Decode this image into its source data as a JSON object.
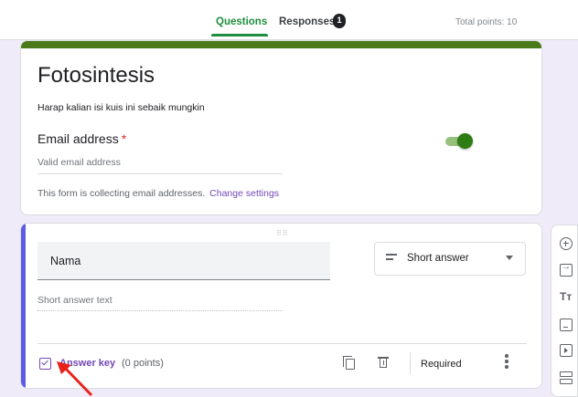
{
  "tabs": [
    {
      "label": "Questions",
      "active": true
    },
    {
      "label": "Responses",
      "active": false,
      "badge": "1"
    }
  ],
  "total_points": "Total points: 10",
  "form": {
    "title": "Fotosintesis",
    "description": "Harap kalian isi kuis ini sebaik mungkin",
    "email_label": "Email address",
    "required_marker": "*",
    "email_placeholder": "Valid email address",
    "collect_text": "This form is collecting email addresses.",
    "change_settings_link": "Change settings"
  },
  "question": {
    "title": "Nama",
    "type": "Short answer",
    "answer_placeholder": "Short answer text",
    "answer_key_label": "Answer key",
    "points": "(0 points)",
    "required_label": "Required",
    "required_on": true
  },
  "side_tools": [
    "add-question-icon",
    "import-questions-icon",
    "add-title-icon",
    "add-image-icon",
    "add-video-icon",
    "add-section-icon"
  ],
  "colors": {
    "theme_accent": "#4a7a19",
    "active_tab": "#1e8e3e",
    "link_purple": "#7248b9",
    "question_focus_bar": "#5e5ce6",
    "annotation_arrow": "#e8221b"
  }
}
